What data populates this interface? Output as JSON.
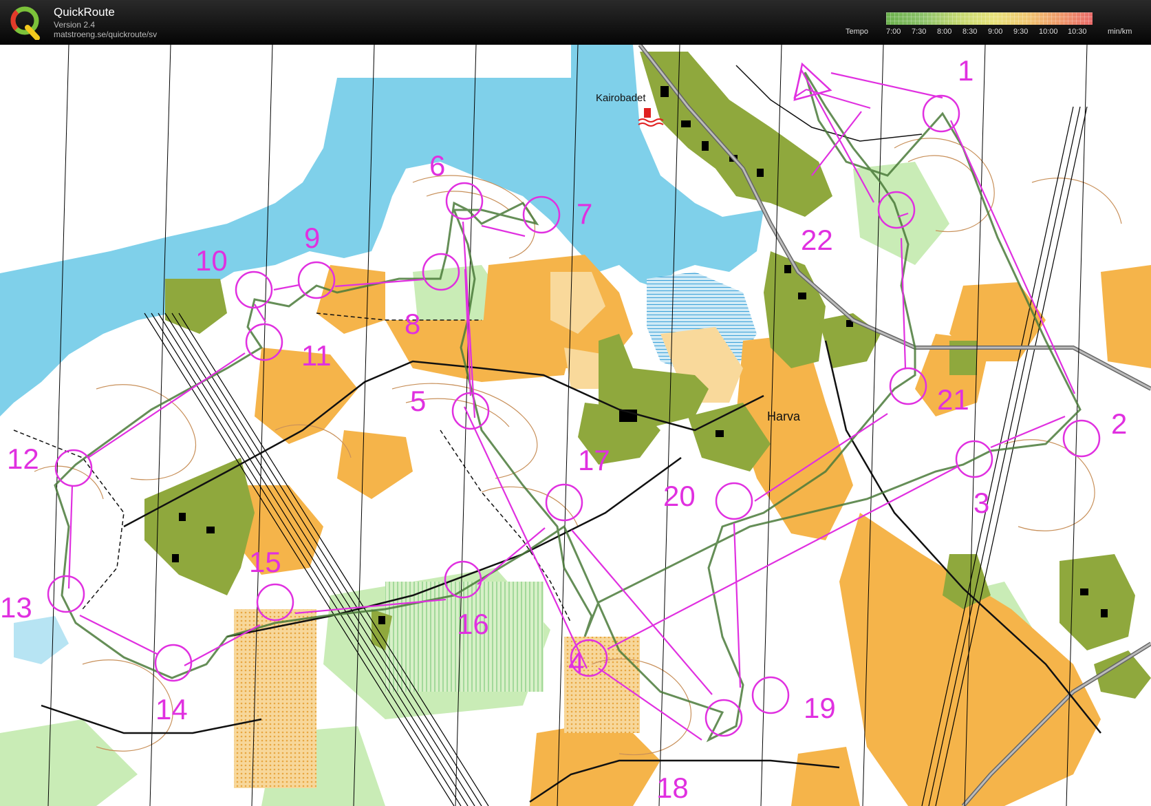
{
  "header": {
    "app_title": "QuickRoute",
    "version": "Version 2.4",
    "url": "matstroeng.se/quickroute/sv",
    "logo_letter": "Q"
  },
  "tempo_legend": {
    "caption": "Tempo",
    "ticks": [
      "7:00",
      "7:30",
      "8:00",
      "8:30",
      "9:00",
      "9:30",
      "10:00",
      "10:30"
    ],
    "unit": "min/km"
  },
  "map": {
    "place_labels": [
      "Kairobadet",
      "Harva"
    ],
    "controls": [
      "1",
      "2",
      "3",
      "4",
      "5",
      "6",
      "7",
      "8",
      "9",
      "10",
      "11",
      "12",
      "13",
      "14",
      "15",
      "16",
      "17",
      "18",
      "19",
      "20",
      "21",
      "22"
    ],
    "course_color": "#e030e0",
    "water_color": "#7fd0ea",
    "open_land_color": "#f5b44a",
    "forest_color": "#8fa83d"
  }
}
